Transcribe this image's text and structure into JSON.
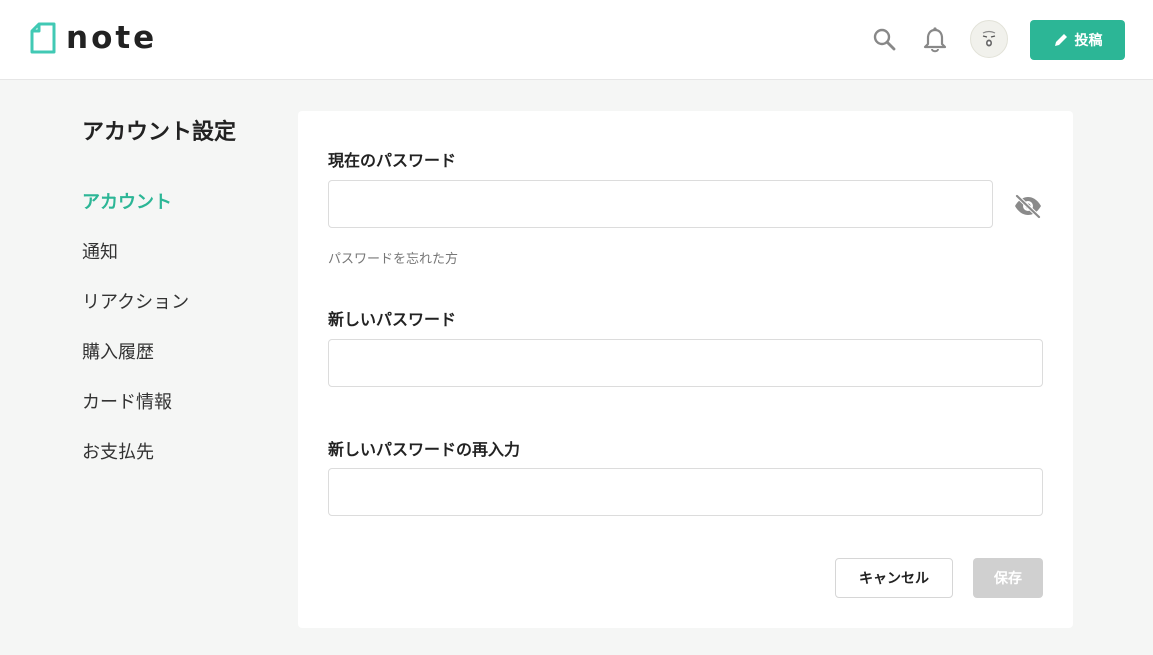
{
  "header": {
    "logo_text": "note",
    "post_label": "投稿",
    "icons": {
      "search": "search-icon",
      "bell": "bell-icon",
      "pencil": "pencil-icon"
    },
    "colors": {
      "accent": "#2cb696"
    }
  },
  "sidebar": {
    "title": "アカウント設定",
    "items": [
      {
        "label": "アカウント",
        "active": true
      },
      {
        "label": "通知",
        "active": false
      },
      {
        "label": "リアクション",
        "active": false
      },
      {
        "label": "購入履歴",
        "active": false
      },
      {
        "label": "カード情報",
        "active": false
      },
      {
        "label": "お支払先",
        "active": false
      }
    ]
  },
  "form": {
    "current_password": {
      "label": "現在のパスワード",
      "value": "",
      "placeholder": ""
    },
    "forgot_link": "パスワードを忘れた方",
    "new_password": {
      "label": "新しいパスワード",
      "value": "",
      "placeholder": ""
    },
    "confirm_password": {
      "label": "新しいパスワードの再入力",
      "value": "",
      "placeholder": ""
    },
    "cancel_label": "キャンセル",
    "save_label": "保存"
  }
}
